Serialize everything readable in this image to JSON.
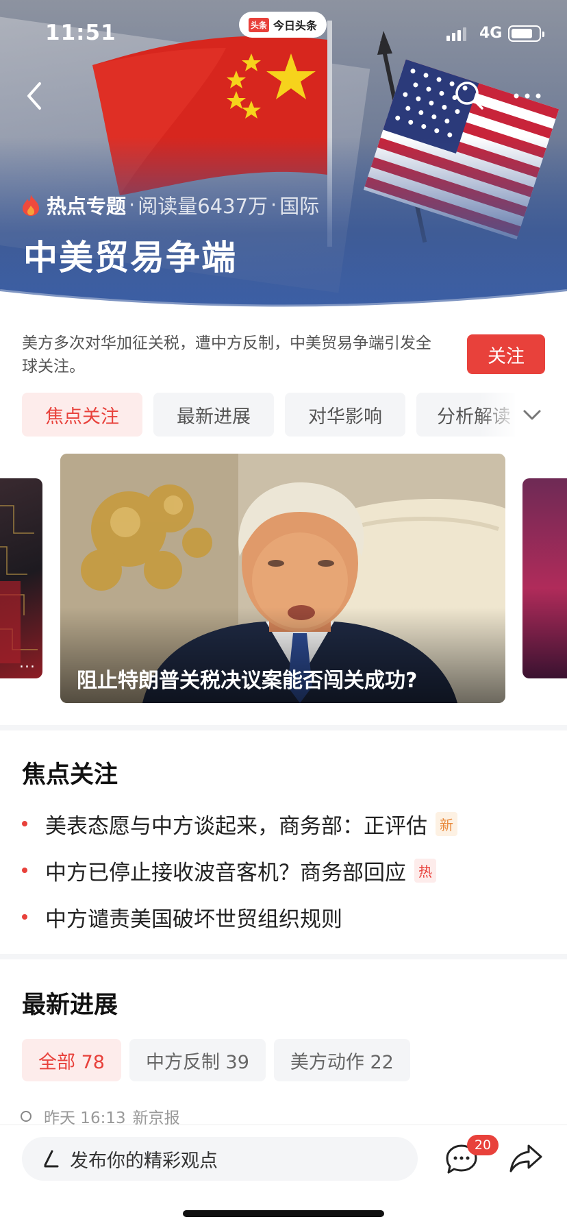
{
  "status_bar": {
    "time": "11:51",
    "app_pill_logo": "头条",
    "app_pill_label": "今日头条",
    "network": "4G",
    "battery_level": 0.8
  },
  "header": {
    "icons": [
      "back-arrow-icon",
      "search-icon",
      "more-icon"
    ],
    "topic_tag": "热点专题",
    "meta_reads": "阅读量6437万",
    "meta_category": "国际",
    "separator": "·",
    "title": "中美贸易争端"
  },
  "intro": {
    "text": "美方多次对华加征关税，遭中方反制，中美贸易争端引发全球关注。",
    "follow_label": "关注"
  },
  "tabs": [
    {
      "label": "焦点关注",
      "active": true
    },
    {
      "label": "最新进展",
      "active": false
    },
    {
      "label": "对华影响",
      "active": false
    },
    {
      "label": "分析解读",
      "active": false
    }
  ],
  "carousel": {
    "main_caption": "阻止特朗普关税决议案能否闯关成功?",
    "left_dots": "..."
  },
  "focus": {
    "title": "焦点关注",
    "items": [
      {
        "text": "美表态愿与中方谈起来，商务部：正评估",
        "badge": "新",
        "badge_type": "new"
      },
      {
        "text": "中方已停止接收波音客机？商务部回应",
        "badge": "热",
        "badge_type": "hot"
      },
      {
        "text": "中方谴责美国破坏世贸组织规则",
        "badge": "",
        "badge_type": ""
      }
    ]
  },
  "latest": {
    "title": "最新进展",
    "chips": [
      {
        "label": "全部 78",
        "active": true
      },
      {
        "label": "中方反制 39",
        "active": false
      },
      {
        "label": "美方动作 22",
        "active": false
      }
    ],
    "first_time": "昨天 16:13",
    "first_source": "新京报"
  },
  "bottom_bar": {
    "input_placeholder": "发布你的精彩观点",
    "comment_count": "20"
  },
  "colors": {
    "accent": "#e8413b",
    "accent_bg": "#fdeceb",
    "chip_bg": "#f4f5f7",
    "hero_blue": "#3f62a8"
  }
}
